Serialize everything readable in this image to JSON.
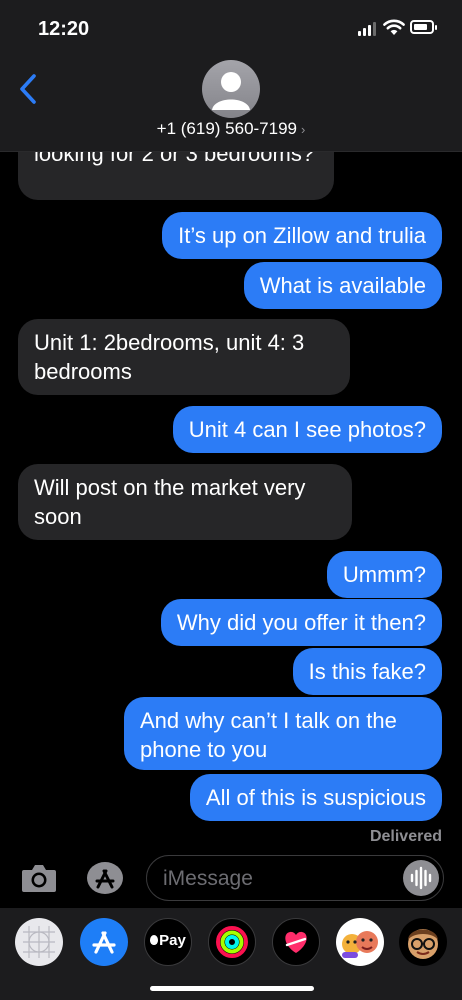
{
  "status": {
    "time": "12:20",
    "battery_percent": 80
  },
  "header": {
    "contact": "+1 (619) 560-7199",
    "chevron": "›"
  },
  "messages": [
    {
      "side": "in",
      "text": "looking for 2 or 3 bedrooms?"
    },
    {
      "side": "out",
      "text": "It’s up on Zillow and trulia"
    },
    {
      "side": "out",
      "text": "What is available"
    },
    {
      "side": "in",
      "text": "Unit 1: 2bedrooms, unit 4: 3 bedrooms"
    },
    {
      "side": "out",
      "text": "Unit 4 can I see photos?"
    },
    {
      "side": "in",
      "text": "Will post on the market very soon"
    },
    {
      "side": "out",
      "text": "Ummm?"
    },
    {
      "side": "out",
      "text": "Why did you offer it then?"
    },
    {
      "side": "out",
      "text": "Is this fake?"
    },
    {
      "side": "out",
      "text": "And why can’t I talk on the phone to you"
    },
    {
      "side": "out",
      "text": "All of this is suspicious"
    }
  ],
  "delivered": "Delivered",
  "composer": {
    "placeholder": "iMessage"
  },
  "apps": [
    {
      "name": "photos-app-icon"
    },
    {
      "name": "app-store-app-icon"
    },
    {
      "name": "apple-pay-app-icon",
      "label": "Pay"
    },
    {
      "name": "activity-app-icon"
    },
    {
      "name": "digital-touch-app-icon"
    },
    {
      "name": "memoji-stickers-app-icon"
    },
    {
      "name": "memoji-app-icon"
    }
  ],
  "colors": {
    "outgoing": "#2c7cf6",
    "incoming": "#262628",
    "accent": "#2c7cf6"
  }
}
